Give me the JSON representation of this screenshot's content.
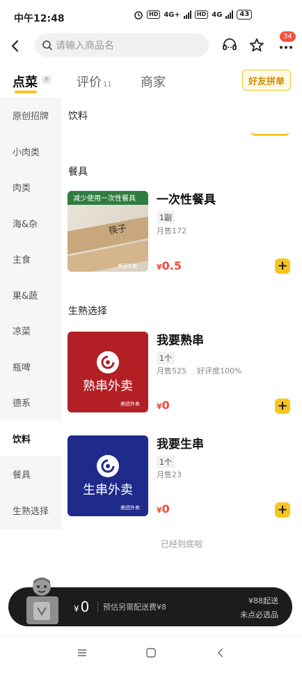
{
  "status": {
    "time": "中午12:48",
    "net1": "4G+",
    "net2": "4G",
    "hd": "HD",
    "battery": "43"
  },
  "search": {
    "placeholder": "请输入商品名"
  },
  "nav": {
    "badge_count": "34"
  },
  "tabs": {
    "items": [
      {
        "label": "点菜",
        "flag": "不"
      },
      {
        "label": "评价",
        "count": "11"
      },
      {
        "label": "商家"
      }
    ],
    "group_order_label": "好友拼单"
  },
  "sidebar": {
    "items": [
      {
        "label": "原创招牌"
      },
      {
        "label": "小肉类"
      },
      {
        "label": "肉类"
      },
      {
        "label": "海&杂"
      },
      {
        "label": "主食"
      },
      {
        "label": "果&蔬"
      },
      {
        "label": "凉菜"
      },
      {
        "label": "瓶啤"
      },
      {
        "label": "德系"
      },
      {
        "label": "饮料"
      },
      {
        "label": "餐具"
      },
      {
        "label": "生熟选择"
      }
    ],
    "active_index": 9
  },
  "sections": {
    "drinks": "饮料",
    "tableware": "餐具",
    "raw_cooked": "生熟选择"
  },
  "products": [
    {
      "name": "一次性餐具",
      "unit": "1副",
      "sales": "月售172",
      "rating": "",
      "price": "0.5",
      "image_banner": "减少使用一次性餐具",
      "image_print": "筷子",
      "image_watermark": "美团外卖"
    },
    {
      "name": "我要熟串",
      "unit": "1个",
      "sales": "月售525",
      "rating": "好评度100%",
      "price": "0",
      "image_text": "熟串外卖",
      "image_watermark": "美团外卖",
      "image_color": "#b21f24"
    },
    {
      "name": "我要生串",
      "unit": "1个",
      "sales": "月售23",
      "rating": "",
      "price": "0",
      "image_text": "生串外卖",
      "image_watermark": "美团外卖",
      "image_color": "#1f2a8a"
    }
  ],
  "currency": "¥",
  "end_text": "已经到底啦",
  "cart": {
    "total": "0",
    "fee_note": "预估另需配送费¥8",
    "min_order": "¥88起送",
    "hint": "未点必选品"
  },
  "colors": {
    "accent": "#f8c51f",
    "price": "#f24a3a",
    "cart_bg": "#1c1c1c",
    "badge": "#f5503c"
  },
  "icons": [
    "back-icon",
    "search-icon",
    "customer-service-icon",
    "star-icon",
    "more-icon",
    "menu-icon",
    "home-icon",
    "back-nav-icon"
  ]
}
